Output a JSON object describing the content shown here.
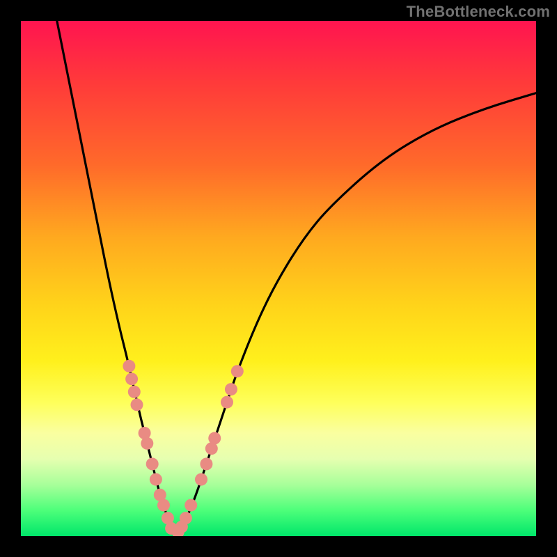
{
  "attribution": "TheBottleneck.com",
  "colors": {
    "curve": "#000000",
    "markers": "#e98b83",
    "background_top": "#ff1450",
    "background_bottom": "#00e66a"
  },
  "chart_data": {
    "type": "line",
    "title": "",
    "xlabel": "",
    "ylabel": "",
    "xlim": [
      0,
      100
    ],
    "ylim": [
      0,
      100
    ],
    "series": [
      {
        "name": "left-branch",
        "x": [
          7,
          9,
          11,
          13,
          15,
          17,
          19,
          21,
          23,
          24,
          25,
          26,
          27,
          28,
          29,
          30
        ],
        "y": [
          100,
          90,
          80,
          70,
          60,
          50,
          41,
          33,
          24,
          20,
          16,
          12,
          8,
          5,
          2,
          0
        ]
      },
      {
        "name": "right-branch",
        "x": [
          30,
          32,
          34,
          36,
          38,
          40,
          42,
          46,
          50,
          55,
          60,
          70,
          80,
          90,
          100
        ],
        "y": [
          0,
          3,
          8,
          14,
          20,
          26,
          32,
          42,
          50,
          58,
          64,
          73,
          79,
          83,
          86
        ]
      }
    ],
    "markers": [
      {
        "branch": "left",
        "x": 21.0,
        "y": 33.0
      },
      {
        "branch": "left",
        "x": 21.5,
        "y": 30.5
      },
      {
        "branch": "left",
        "x": 22.0,
        "y": 28.0
      },
      {
        "branch": "left",
        "x": 22.5,
        "y": 25.5
      },
      {
        "branch": "left",
        "x": 24.0,
        "y": 20.0
      },
      {
        "branch": "left",
        "x": 24.5,
        "y": 18.0
      },
      {
        "branch": "left",
        "x": 25.5,
        "y": 14.0
      },
      {
        "branch": "left",
        "x": 26.2,
        "y": 11.0
      },
      {
        "branch": "left",
        "x": 27.0,
        "y": 8.0
      },
      {
        "branch": "left",
        "x": 27.7,
        "y": 6.0
      },
      {
        "branch": "left",
        "x": 28.5,
        "y": 3.5
      },
      {
        "branch": "left",
        "x": 29.2,
        "y": 1.5
      },
      {
        "branch": "right",
        "x": 30.5,
        "y": 0.8
      },
      {
        "branch": "right",
        "x": 31.2,
        "y": 1.8
      },
      {
        "branch": "right",
        "x": 32.0,
        "y": 3.5
      },
      {
        "branch": "right",
        "x": 33.0,
        "y": 6.0
      },
      {
        "branch": "right",
        "x": 35.0,
        "y": 11.0
      },
      {
        "branch": "right",
        "x": 36.0,
        "y": 14.0
      },
      {
        "branch": "right",
        "x": 37.0,
        "y": 17.0
      },
      {
        "branch": "right",
        "x": 37.6,
        "y": 19.0
      },
      {
        "branch": "right",
        "x": 40.0,
        "y": 26.0
      },
      {
        "branch": "right",
        "x": 40.8,
        "y": 28.5
      },
      {
        "branch": "right",
        "x": 42.0,
        "y": 32.0
      }
    ]
  }
}
